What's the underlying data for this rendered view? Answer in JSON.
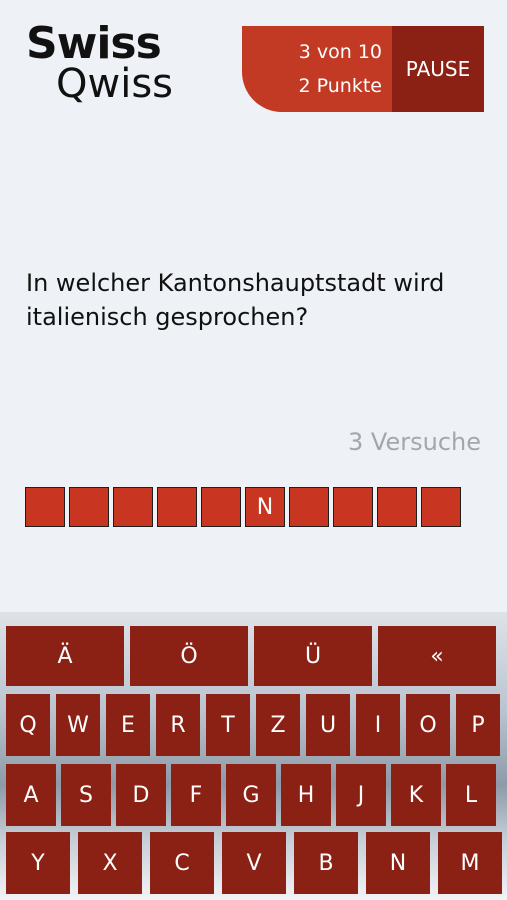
{
  "logo": {
    "line1": "Swiss",
    "line2": "Qwiss"
  },
  "score": {
    "progress": "3 von 10",
    "points": "2 Punkte",
    "pause_label": "PAUSE"
  },
  "question": "In welcher Kantonshauptstadt wird italienisch gesprochen?",
  "attempts": "3 Versuche",
  "answer_slots": [
    "",
    "",
    "",
    "",
    "",
    "N",
    "",
    "",
    "",
    ""
  ],
  "keyboard": {
    "row0": [
      "Ä",
      "Ö",
      "Ü",
      "«"
    ],
    "row1": [
      "Q",
      "W",
      "E",
      "R",
      "T",
      "Z",
      "U",
      "I",
      "O",
      "P"
    ],
    "row2": [
      "A",
      "S",
      "D",
      "F",
      "G",
      "H",
      "J",
      "K",
      "L"
    ],
    "row3": [
      "Y",
      "X",
      "C",
      "V",
      "B",
      "N",
      "M"
    ]
  },
  "colors": {
    "accent": "#c23a24",
    "dark_accent": "#8b2115",
    "slot": "#c83520",
    "background": "#eef2f7"
  }
}
